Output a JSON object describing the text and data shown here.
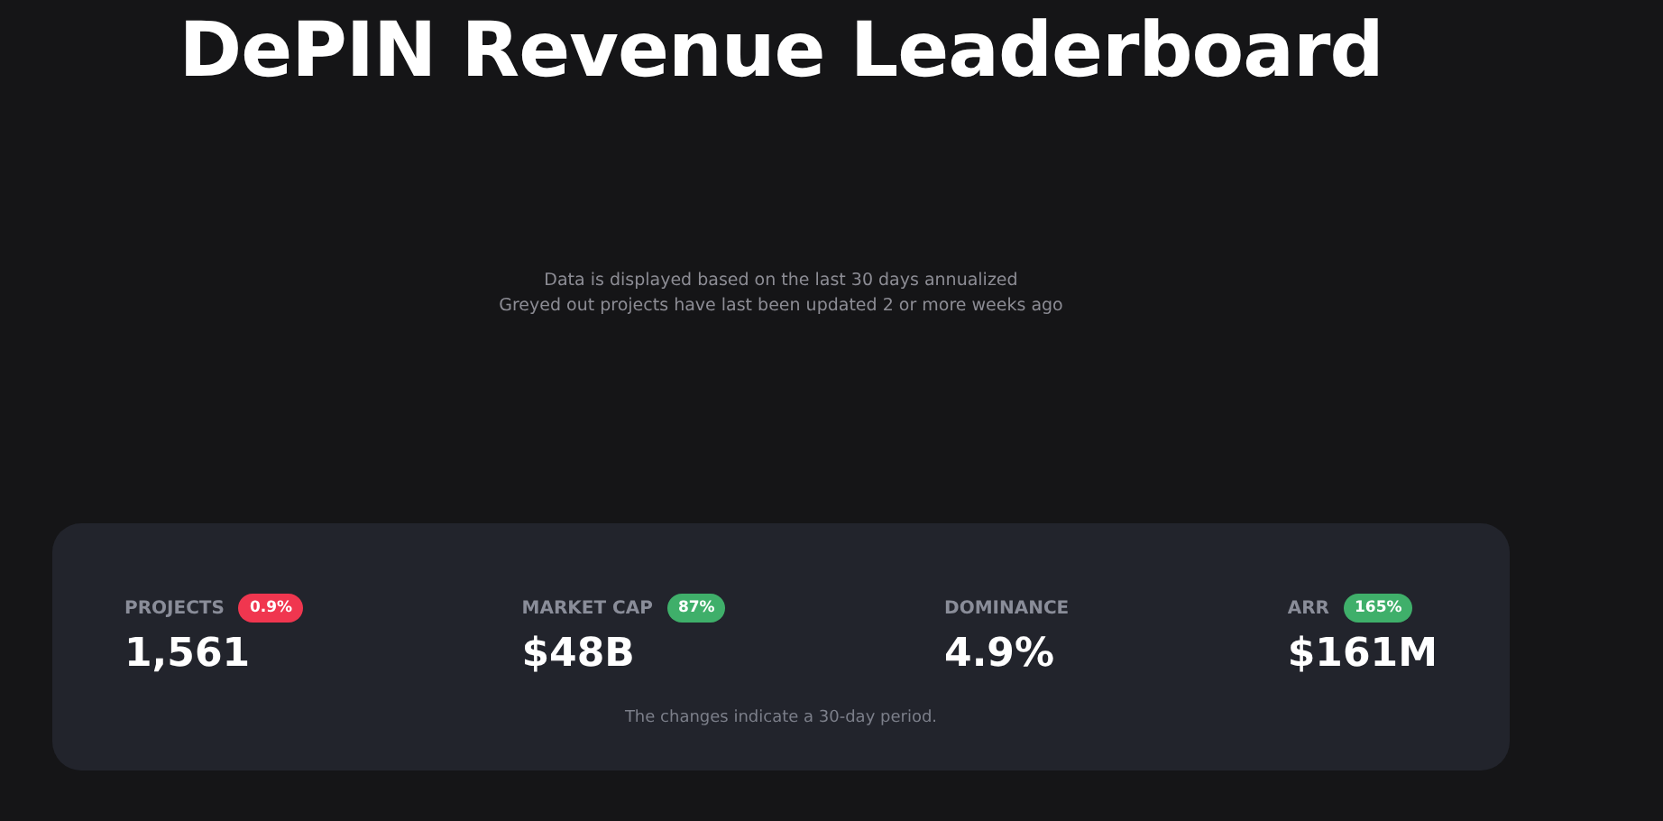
{
  "title": "DePIN Revenue Leaderboard",
  "notes": [
    "Data is displayed based on the last 30 days annualized",
    "Greyed out projects have last been updated 2 or more weeks ago"
  ],
  "stats": [
    {
      "label": "PROJECTS",
      "badge": {
        "text": "0.9%",
        "color": "#f0364f"
      },
      "value": "1,561"
    },
    {
      "label": "MARKET CAP",
      "badge": {
        "text": "87%",
        "color": "#3faf6a"
      },
      "value": "$48B"
    },
    {
      "label": "DOMINANCE",
      "value": "4.9%"
    },
    {
      "label": "ARR",
      "badge": {
        "text": "165%",
        "color": "#3faf6a"
      },
      "value": "$161M"
    }
  ],
  "footnote": "The changes indicate a 30-day period."
}
